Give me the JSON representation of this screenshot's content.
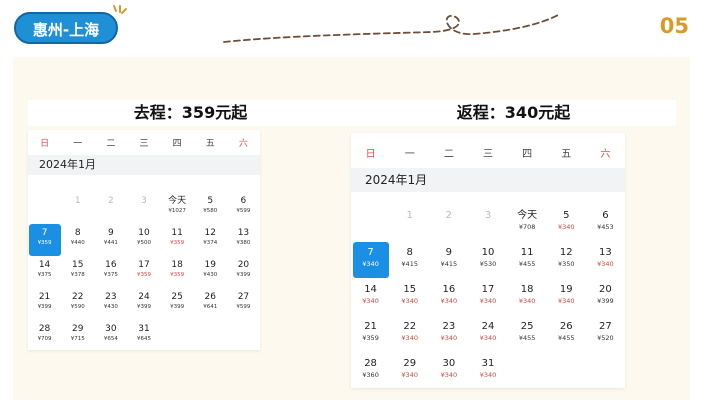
{
  "header": {
    "route": "惠州-上海",
    "page_number": "05"
  },
  "colors": {
    "badge": "#1f8fd6",
    "page_number": "#d89a28",
    "panel": "#fdf9ee",
    "selected": "#1a8fe3",
    "low_price": "#d0463e"
  },
  "outbound": {
    "title": "去程：359元起",
    "month": "2024年1月",
    "weekdays": [
      "日",
      "一",
      "二",
      "三",
      "四",
      "五",
      "六"
    ],
    "days": [
      {
        "d": "1",
        "p": "",
        "muted": true
      },
      {
        "d": "2",
        "p": "",
        "muted": true
      },
      {
        "d": "3",
        "p": "",
        "muted": true
      },
      {
        "d": "今天",
        "p": "¥1027"
      },
      {
        "d": "5",
        "p": "¥580"
      },
      {
        "d": "6",
        "p": "¥599"
      },
      {
        "d": "7",
        "p": "¥359",
        "sel": true
      },
      {
        "d": "8",
        "p": "¥440"
      },
      {
        "d": "9",
        "p": "¥441"
      },
      {
        "d": "10",
        "p": "¥500"
      },
      {
        "d": "11",
        "p": "¥359",
        "red": true
      },
      {
        "d": "12",
        "p": "¥374"
      },
      {
        "d": "13",
        "p": "¥380"
      },
      {
        "d": "14",
        "p": "¥375"
      },
      {
        "d": "15",
        "p": "¥378"
      },
      {
        "d": "16",
        "p": "¥375"
      },
      {
        "d": "17",
        "p": "¥359",
        "red": true
      },
      {
        "d": "18",
        "p": "¥359",
        "red": true
      },
      {
        "d": "19",
        "p": "¥430"
      },
      {
        "d": "20",
        "p": "¥399"
      },
      {
        "d": "21",
        "p": "¥399"
      },
      {
        "d": "22",
        "p": "¥590"
      },
      {
        "d": "23",
        "p": "¥430"
      },
      {
        "d": "24",
        "p": "¥399"
      },
      {
        "d": "25",
        "p": "¥399"
      },
      {
        "d": "26",
        "p": "¥641"
      },
      {
        "d": "27",
        "p": "¥599"
      },
      {
        "d": "28",
        "p": "¥709"
      },
      {
        "d": "29",
        "p": "¥715"
      },
      {
        "d": "30",
        "p": "¥654"
      },
      {
        "d": "31",
        "p": "¥645"
      }
    ]
  },
  "return": {
    "title": "返程：340元起",
    "month": "2024年1月",
    "weekdays": [
      "日",
      "一",
      "二",
      "三",
      "四",
      "五",
      "六"
    ],
    "days": [
      {
        "d": "1",
        "p": "",
        "muted": true
      },
      {
        "d": "2",
        "p": "",
        "muted": true
      },
      {
        "d": "3",
        "p": "",
        "muted": true
      },
      {
        "d": "今天",
        "p": "¥708"
      },
      {
        "d": "5",
        "p": "¥340",
        "red": true
      },
      {
        "d": "6",
        "p": "¥453"
      },
      {
        "d": "7",
        "p": "¥340",
        "sel": true
      },
      {
        "d": "8",
        "p": "¥415"
      },
      {
        "d": "9",
        "p": "¥415"
      },
      {
        "d": "10",
        "p": "¥530"
      },
      {
        "d": "11",
        "p": "¥455"
      },
      {
        "d": "12",
        "p": "¥350"
      },
      {
        "d": "13",
        "p": "¥340",
        "red": true
      },
      {
        "d": "14",
        "p": "¥340",
        "red": true
      },
      {
        "d": "15",
        "p": "¥340",
        "red": true
      },
      {
        "d": "16",
        "p": "¥340",
        "red": true
      },
      {
        "d": "17",
        "p": "¥340",
        "red": true
      },
      {
        "d": "18",
        "p": "¥340",
        "red": true
      },
      {
        "d": "19",
        "p": "¥340",
        "red": true
      },
      {
        "d": "20",
        "p": "¥399"
      },
      {
        "d": "21",
        "p": "¥359"
      },
      {
        "d": "22",
        "p": "¥340",
        "red": true
      },
      {
        "d": "23",
        "p": "¥340",
        "red": true
      },
      {
        "d": "24",
        "p": "¥340",
        "red": true
      },
      {
        "d": "25",
        "p": "¥455"
      },
      {
        "d": "26",
        "p": "¥455"
      },
      {
        "d": "27",
        "p": "¥520"
      },
      {
        "d": "28",
        "p": "¥360"
      },
      {
        "d": "29",
        "p": "¥340",
        "red": true
      },
      {
        "d": "30",
        "p": "¥340",
        "red": true
      },
      {
        "d": "31",
        "p": "¥340",
        "red": true
      }
    ]
  }
}
